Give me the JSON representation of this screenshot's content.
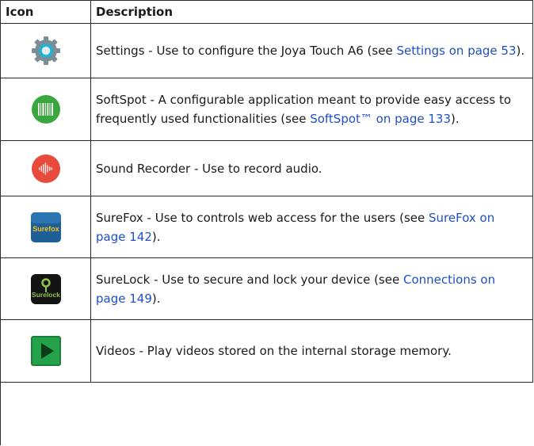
{
  "header": {
    "col_icon": "Icon",
    "col_desc": "Description"
  },
  "rows": [
    {
      "icon": "settings-gear-icon",
      "text": "Settings - Use to configure the Joya Touch A6 (see ",
      "link": "Settings on page 53",
      "tail": ")."
    },
    {
      "icon": "softspot-barcode-icon",
      "text": "SoftSpot - A configurable application meant to provide easy access to frequently used functionalities (see ",
      "link": "SoftSpot™ on page 133",
      "tail": ")."
    },
    {
      "icon": "sound-recorder-icon",
      "text": "Sound Recorder - Use to record audio.",
      "link": "",
      "tail": ""
    },
    {
      "icon": "surefox-icon",
      "icon_text": "Surefox",
      "text": "SureFox - Use to controls web access for the users (see ",
      "link": "SureFox on page 142",
      "tail": ")."
    },
    {
      "icon": "surelock-icon",
      "icon_text": "Surelock",
      "text": "SureLock - Use to secure and lock your device (see ",
      "link": "Connections on page 149",
      "tail": ")."
    },
    {
      "icon": "videos-play-icon",
      "text": "Videos - Play videos stored on the internal storage memory.",
      "link": "",
      "tail": ""
    }
  ],
  "colors": {
    "link": "#1f4fc2",
    "border": "#2b2b2b",
    "softspot_green": "#3aa63e",
    "recorder_red": "#e84a3b",
    "surefox_blue": "#1f5f97",
    "videos_green": "#23a24a"
  }
}
